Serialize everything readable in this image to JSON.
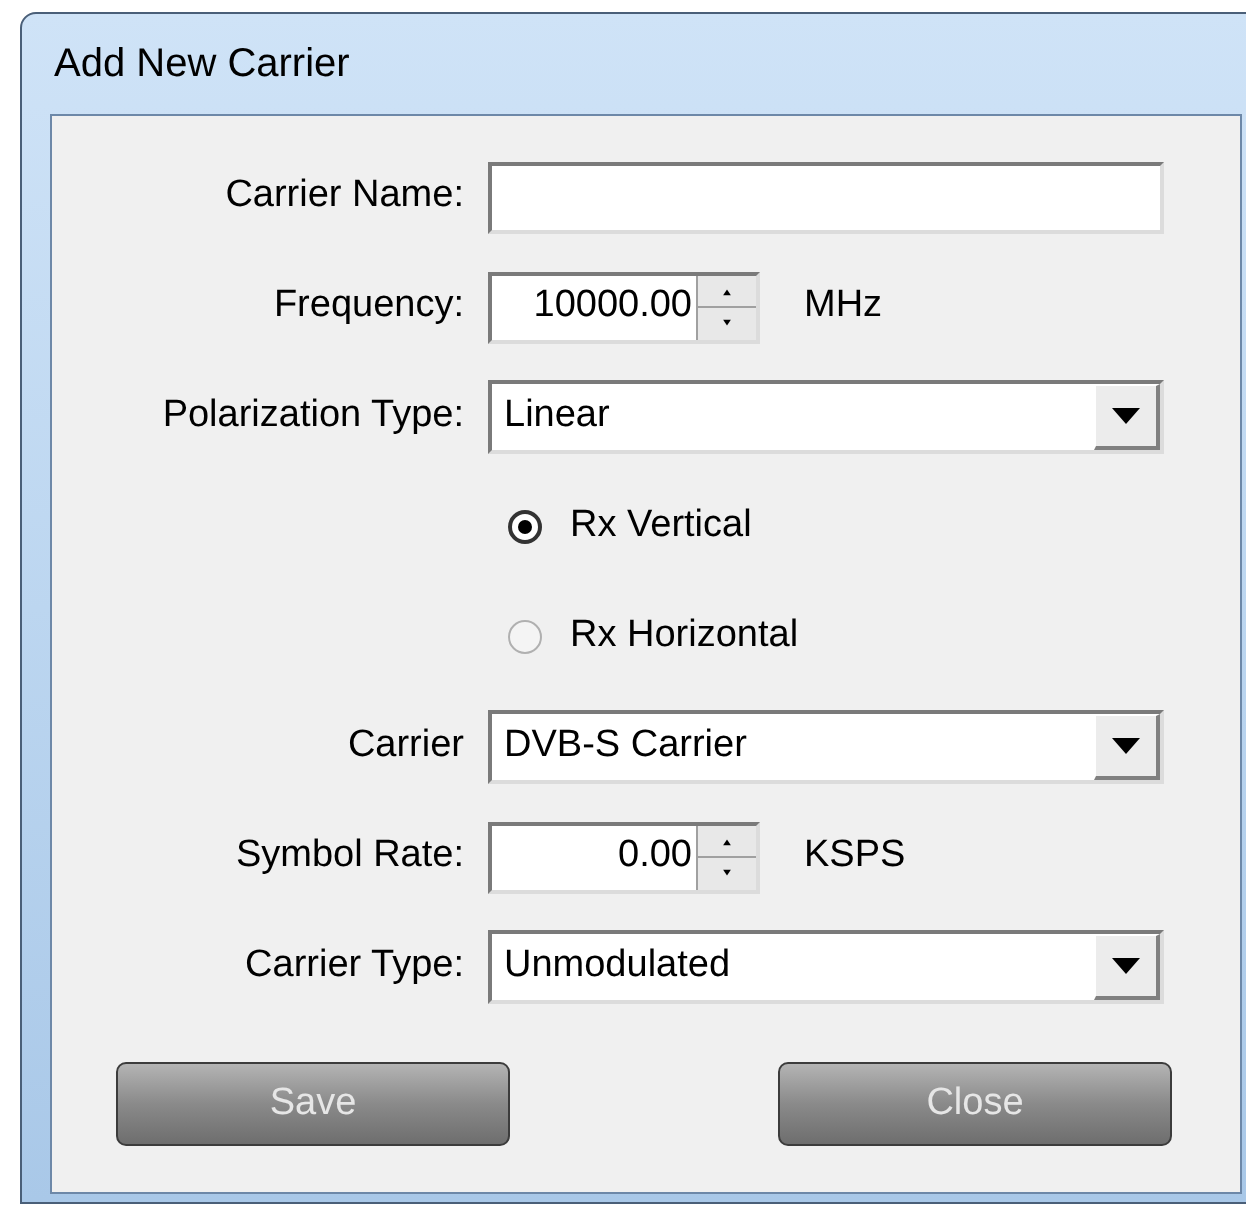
{
  "window": {
    "title": "Add New Carrier"
  },
  "fields": [
    {
      "kind": "text",
      "label": "Carrier Name:"
    },
    {
      "kind": "spin",
      "label": "Frequency:",
      "value": "10000.00",
      "unit": "MHz"
    },
    {
      "kind": "select",
      "label": "Polarization Type:",
      "value": "Linear"
    },
    {
      "kind": "radio",
      "label": "Rx Vertical",
      "selected": true
    },
    {
      "kind": "radio",
      "label": "Rx Horizontal",
      "selected": false
    },
    {
      "kind": "select",
      "label": "Carrier",
      "value": "DVB-S Carrier"
    },
    {
      "kind": "spin",
      "label": "Symbol Rate:",
      "value": "0.00",
      "unit": "KSPS"
    },
    {
      "kind": "select",
      "label": "Carrier Type:",
      "value": "Unmodulated"
    }
  ],
  "buttons": [
    "Save",
    "Close"
  ]
}
